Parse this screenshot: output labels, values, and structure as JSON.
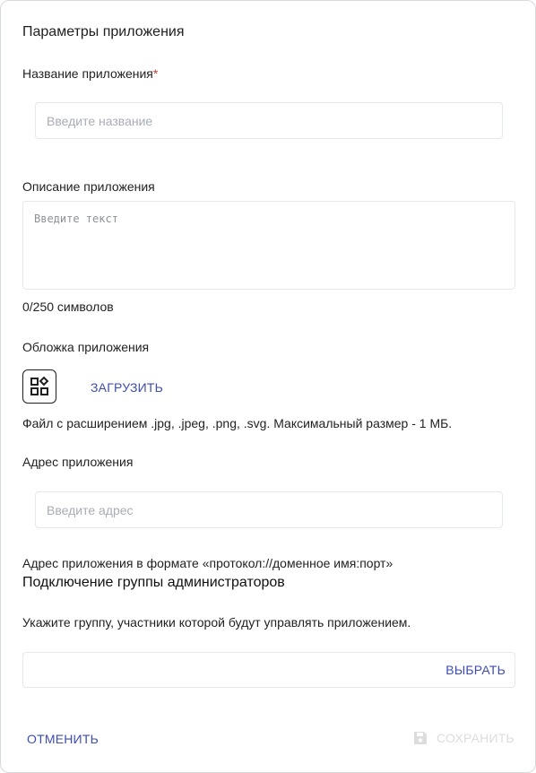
{
  "form": {
    "title": "Параметры приложения",
    "name_label": "Название приложения",
    "required_mark": "*",
    "name_placeholder": "Введите название",
    "description_label": "Описание приложения",
    "description_placeholder": "Введите текст",
    "char_counter": "0/250 символов",
    "cover_label": "Обложка приложения",
    "upload_label": "ЗАГРУЗИТЬ",
    "file_hint": "Файл с расширением .jpg, .jpeg, .png, .svg. Максимальный размер - 1 МБ.",
    "address_label": "Адрес приложения",
    "address_placeholder": "Введите адрес",
    "address_hint": "Адрес приложения в формате «протокол://доменное имя:порт»"
  },
  "admin_group": {
    "title": "Подключение группы администраторов",
    "hint": "Укажите группу, участники которой будут управлять приложением.",
    "select_label": "ВЫБРАТЬ"
  },
  "footer": {
    "cancel_label": "ОТМЕНИТЬ",
    "save_label": "СОХРАНИТЬ",
    "save_icon": "floppy-disk-icon"
  },
  "colors": {
    "accent": "#3d4db0",
    "required": "#d23a2e",
    "border": "#e6e8eb"
  }
}
